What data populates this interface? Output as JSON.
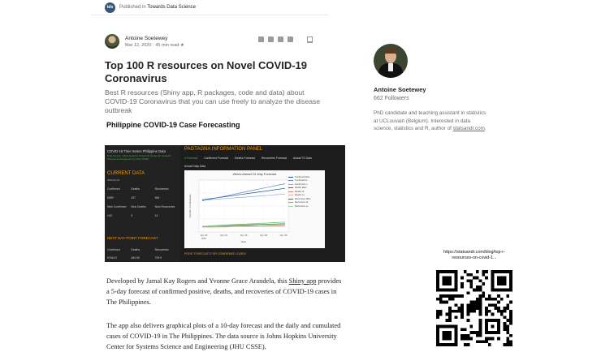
{
  "publication": {
    "logo": "tds",
    "published_in": "Published in",
    "name": "Towards Data Science"
  },
  "author": {
    "name": "Antoine Soetewey",
    "date": "Mar 12, 2020",
    "read_time": "45 min read",
    "star": "★"
  },
  "article": {
    "title": "Top 100 R resources on Novel COVID-19 Coronavirus",
    "subtitle": "Best R resources (Shiny app, R packages, code and data) about COVID-19 Coronavirus that you can use freely to analyze the disease outbreak",
    "section_heading": "Philippine COVID-19 Case Forecasting",
    "para1_prefix": "Developed by Jamal Kay Rogers and Yvonne Grace Arandela, this ",
    "para1_link": "Shiny app",
    "para1_suffix": " provides a 5-day forecast of confirmed positive, deaths, and recoveries of COVID-19 cases in The Philippines.",
    "para2": "The app also delivers graphical plots of a 10-day forecast and the daily and cumulated cases of COVID-19 in The Philippines. The data source is Johns Hopkins University Center for Systems Science and Engineering (JHU CSSE)."
  },
  "app_screenshot": {
    "left_title": "COVID-19 Time Series Philippine Data",
    "left_sub": "Data Source: Johns Hopkins University Center for Systems Science and Engineering (JHU CSSE)",
    "current_data": "CURRENT DATA",
    "current_date": "2020-04-21",
    "stats": [
      "Confirmed",
      "Deaths",
      "Recoveries",
      "6599",
      "437",
      "654",
      "New Confirmed",
      "New Deaths",
      "New Recoveries",
      "140",
      "9",
      "41"
    ],
    "next_day": "NEXT DAY POINT FORECAST",
    "next_stats": [
      "Confirmed",
      "Deaths",
      "Recoveries",
      "6766.67",
      "454.35",
      "709.9"
    ],
    "panel_title": "PAGTAGNA INFORMATION PANEL",
    "tabs": [
      "4-Forecast",
      "Confirmed Forecast",
      "Deaths Forecast",
      "Recoveries Forecast",
      "Actual TS Data"
    ],
    "actual_tab": "Actual Daily Data",
    "chart_title": "Week-Ahead 10-Day Forecast",
    "legend": [
      "Confirmed Main",
      "Confirmed Hi",
      "Confirmed Lo",
      "Deaths Main",
      "Deaths Hi",
      "Deaths Lo",
      "Recoveries Main",
      "Recoveries Hi",
      "Recoveries Lo"
    ],
    "legend_colors": [
      "#1f4e9c",
      "#5f86c9",
      "#8fb0e0",
      "#c0392b",
      "#e57373",
      "#f1a8a8",
      "#2e7d32",
      "#66bb6a",
      "#a5d6a7"
    ],
    "x_ticks": [
      "Apr 22",
      "Apr 24",
      "Apr 26",
      "Apr 28",
      "Apr 30"
    ],
    "x_year": "2020",
    "x_label": "Date",
    "y_label": "Number of Individuals",
    "footer": "POINT FORECAST FOR CONFIRMED CASES"
  },
  "sidebar": {
    "name": "Antoine Soetewey",
    "followers": "662 Followers",
    "bio_prefix": "PhD candidate and teaching assistant in statistics at UCLouvain (Belgium). Interested in data science, statistics and R, author of ",
    "bio_link": "statsandr.com",
    "bio_suffix": "."
  },
  "qr": {
    "url": "https://statsandr.com/blog/top-r-resources-on-covid-1..."
  }
}
